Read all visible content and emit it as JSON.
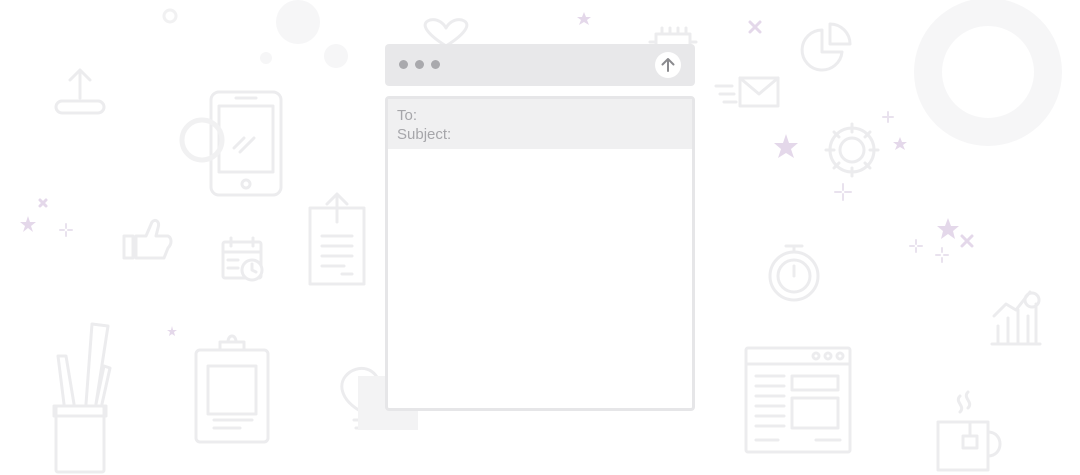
{
  "compose": {
    "to_label": "To:",
    "to_value": "",
    "subject_label": "Subject:",
    "subject_value": "",
    "message_value": "",
    "window_dots": [
      "dot",
      "dot",
      "dot"
    ],
    "send_icon": "arrow-up-icon"
  },
  "background_icons": [
    "upload-tray-icon",
    "smartphone-icon",
    "thumbs-up-icon",
    "calendar-clock-icon",
    "document-upload-icon",
    "pencil-cup-icon",
    "clipboard-icon",
    "lightbulb-icon",
    "heart-icon",
    "chip-icon",
    "email-fast-icon",
    "pie-chart-icon",
    "gear-icon",
    "stopwatch-icon",
    "browser-layout-icon",
    "growth-chart-icon",
    "coffee-cup-icon",
    "star-icon",
    "sparkle-icon",
    "ring-decoration"
  ],
  "colors": {
    "background": "#ffffff",
    "icon_stroke": "#ececee",
    "accent_star": "#d9c8e2",
    "titlebar": "#e8e8ea",
    "label_text": "#a6a6aa"
  }
}
